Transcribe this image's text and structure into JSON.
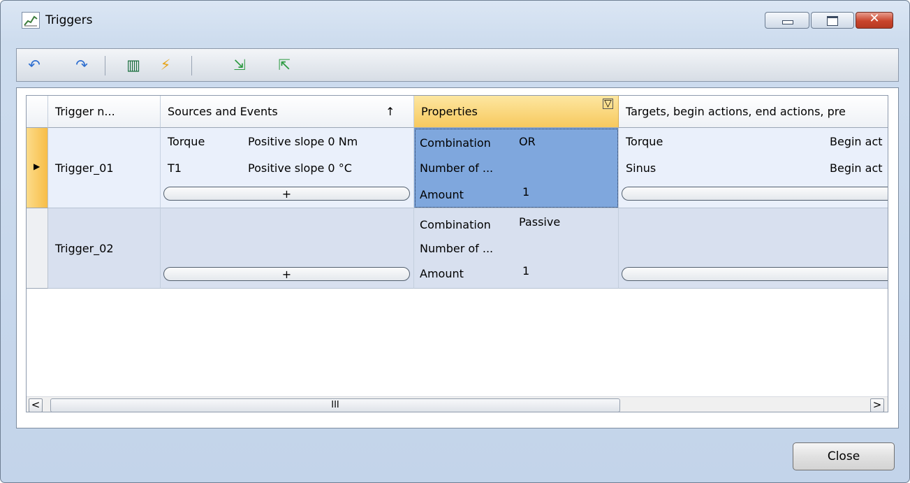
{
  "window": {
    "title": "Triggers"
  },
  "toolbar": {
    "items": [
      {
        "name": "undo-icon",
        "glyph": "↶",
        "color": "#2f6fd0"
      },
      {
        "name": "redo-icon",
        "glyph": "↷",
        "color": "#2f6fd0"
      },
      {
        "name": "columns-icon",
        "glyph": "▥",
        "color": "#1b6f3f"
      },
      {
        "name": "flash-icon",
        "glyph": "⚡",
        "color": "#e7a51b"
      },
      {
        "name": "import-icon",
        "glyph": "⇲",
        "color": "#2d9b42"
      },
      {
        "name": "export-icon",
        "glyph": "⇱",
        "color": "#2d9b42"
      }
    ]
  },
  "grid": {
    "columns": [
      {
        "label": "Trigger n..."
      },
      {
        "label": "Sources and Events",
        "sort": "↑"
      },
      {
        "label": "Properties",
        "filter": "▽"
      },
      {
        "label": "Targets, begin actions, end actions, pre"
      }
    ],
    "rows": [
      {
        "name": "Trigger_01",
        "sources": [
          {
            "source": "Torque",
            "event": "Positive slope 0 Nm"
          },
          {
            "source": "T1",
            "event": "Positive slope 0 °C"
          }
        ],
        "add_label": "+",
        "properties": [
          {
            "key": "Combination",
            "value": "OR"
          },
          {
            "key": "Number of ...",
            "value": ""
          },
          {
            "key": "Amount",
            "value": "1"
          }
        ],
        "targets": [
          {
            "target": "Torque",
            "action": "Begin act"
          },
          {
            "target": "Sinus",
            "action": "Begin act"
          }
        ]
      },
      {
        "name": "Trigger_02",
        "sources": [],
        "add_label": "+",
        "properties": [
          {
            "key": "Combination",
            "value": "Passive"
          },
          {
            "key": "Number of ...",
            "value": ""
          },
          {
            "key": "Amount",
            "value": "1"
          }
        ],
        "targets": []
      }
    ],
    "scrollbar": {
      "left": "<",
      "right": ">",
      "thumb": "III"
    }
  },
  "footer": {
    "close_label": "Close"
  }
}
